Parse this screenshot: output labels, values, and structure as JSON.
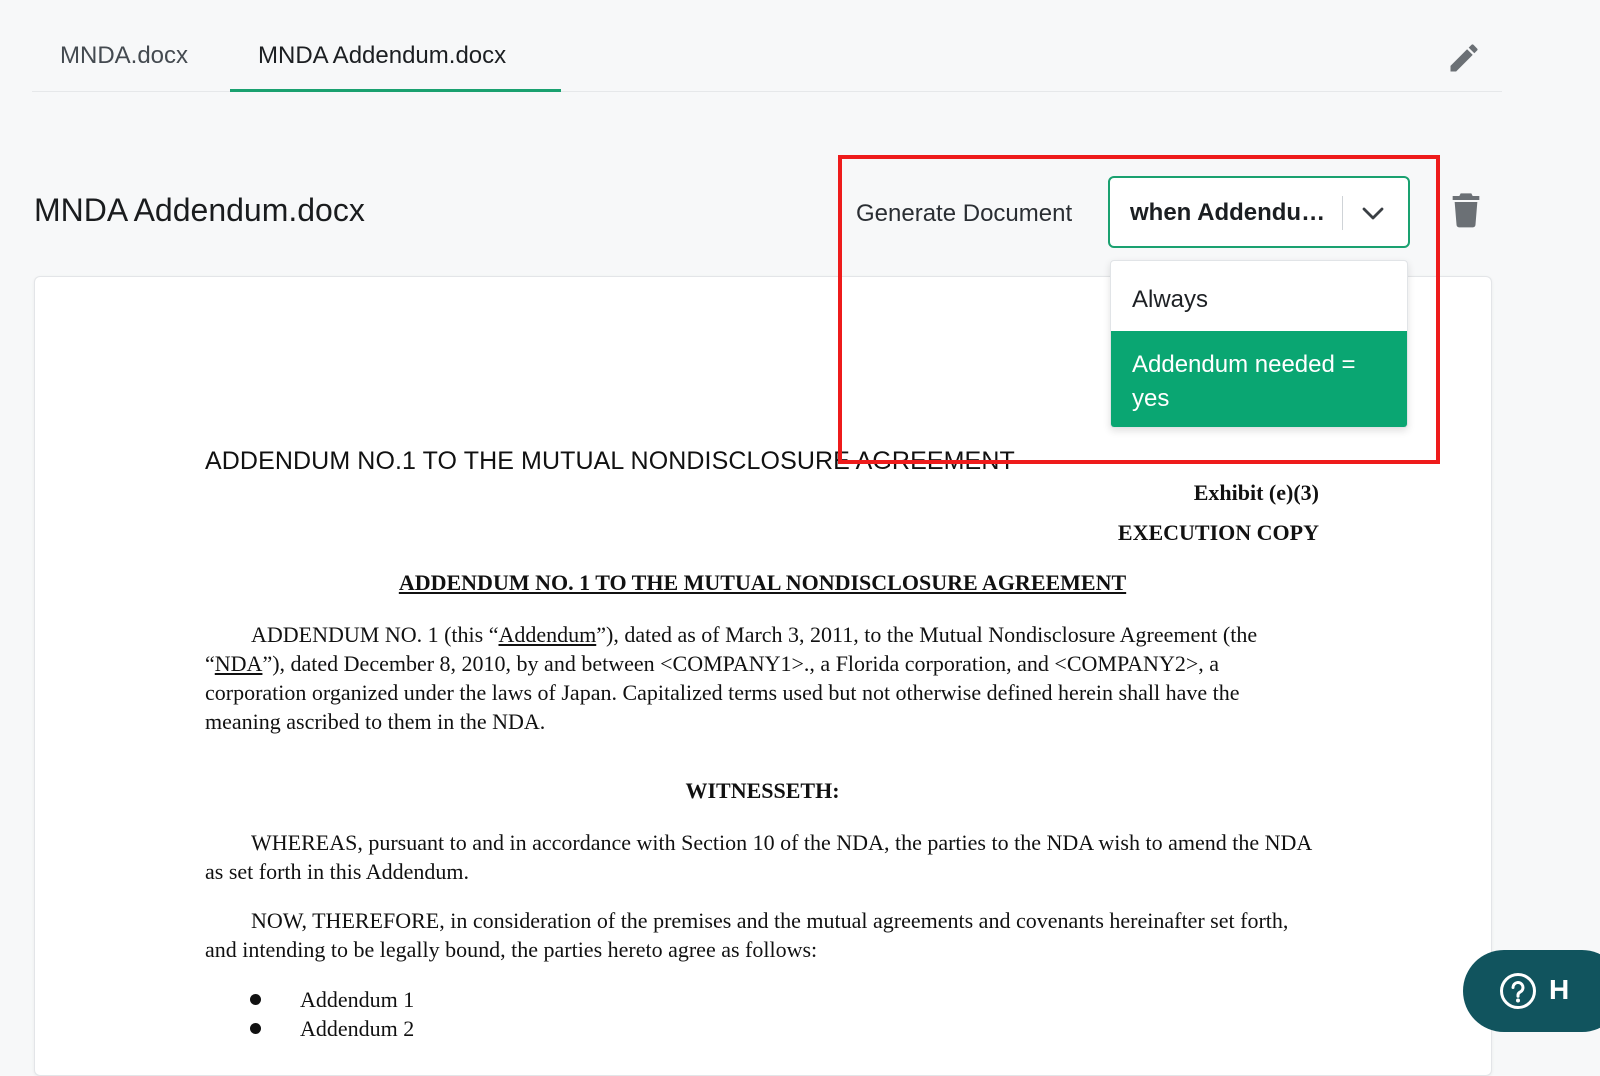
{
  "tabs": [
    {
      "label": "MNDA.docx"
    },
    {
      "label": "MNDA Addendum.docx"
    }
  ],
  "header": {
    "title": "MNDA Addendum.docx",
    "generate_label": "Generate Document",
    "select_value": "when Addendum needed = yes"
  },
  "dropdown": {
    "options": [
      {
        "label": "Always"
      },
      {
        "label": "Addendum needed = yes"
      }
    ]
  },
  "document": {
    "heading_sans": "ADDENDUM NO.1 TO THE MUTUAL NONDISCLOSURE AGREEMENT",
    "exhibit": "Exhibit (e)(3)",
    "execution_copy": "EXECUTION COPY",
    "heading_serif": "ADDENDUM NO. 1 TO THE MUTUAL NONDISCLOSURE AGREEMENT",
    "p1": {
      "a": "ADDENDUM NO. 1 (this “",
      "addendum_term": "Addendum",
      "b": "”), dated as of March 3, 2011, to the Mutual Nondisclosure Agreement (the “",
      "nda_term": "NDA",
      "c": "”), dated December 8, 2010, by and between <COMPANY1>., a Florida corporation, and <COMPANY2>, a corporation organized under the laws of Japan. Capitalized terms used but not otherwise defined herein shall have the meaning ascribed to them in the NDA."
    },
    "witnesseth": "WITNESSETH:",
    "p2": "WHEREAS, pursuant to and in accordance with Section 10 of the NDA, the parties to the NDA wish to amend the NDA as set forth in this Addendum.",
    "p3": "NOW, THEREFORE, in consideration of the premises and the mutual agreements and covenants hereinafter set forth, and intending to be legally bound, the parties hereto agree as follows:",
    "bullets": [
      "Addendum 1",
      "Addendum 2"
    ]
  },
  "help": {
    "label": "H"
  },
  "colors": {
    "accent": "#1aa170",
    "selected_option": "#0aa672",
    "highlight": "#ee1b1b",
    "help_bg": "#11545e"
  },
  "icons": [
    "pencil-icon",
    "chevron-down-icon",
    "trash-icon",
    "help-circle-icon"
  ]
}
